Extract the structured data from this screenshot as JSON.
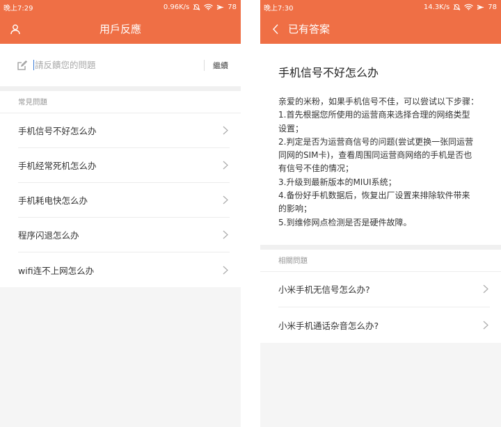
{
  "left": {
    "status": {
      "time": "晚上7:29",
      "speed": "0.96K/s",
      "battery": "78"
    },
    "appbar": {
      "title": "用戶反應",
      "user_icon": "user-icon"
    },
    "search": {
      "placeholder": "請反饋您的問題",
      "value": "",
      "continue_label": "繼續"
    },
    "faq": {
      "header": "常見問題",
      "items": [
        {
          "label": "手机信号不好怎么办"
        },
        {
          "label": "手机经常死机怎么办"
        },
        {
          "label": "手机耗电快怎么办"
        },
        {
          "label": "程序闪退怎么办"
        },
        {
          "label": "wifi连不上网怎么办"
        }
      ]
    }
  },
  "right": {
    "status": {
      "time": "晚上7:30",
      "speed": "14.3K/s",
      "battery": "78"
    },
    "appbar": {
      "title": "已有答案",
      "back_icon": "back-arrow-icon"
    },
    "answer": {
      "title": "手机信号不好怎么办",
      "lines": [
        "亲爱的米粉，如果手机信号不佳，可以尝试以下步骤：",
        "1.首先根据您所使用的运营商来选择合理的网络类型",
        "设置；",
        "2.判定是否为运营商信号的问题(尝试更换一张同运营",
        "同网的SIM卡)，查看周围同运营商网络的手机是否也",
        "有信号不佳的情况；",
        "3.升级到最新版本的MIUI系统；",
        "4.备份好手机数据后，恢复出厂设置来排除软件带来",
        "的影响；",
        "5.到维修网点检测是否是硬件故障。"
      ]
    },
    "related": {
      "header": "相關問題",
      "items": [
        {
          "label": "小米手机无信号怎么办?"
        },
        {
          "label": "小米手机通话杂音怎么办?"
        }
      ]
    }
  },
  "colors": {
    "accent": "#ef6f45",
    "background": "#f5f5f5",
    "divider": "#ececec"
  }
}
